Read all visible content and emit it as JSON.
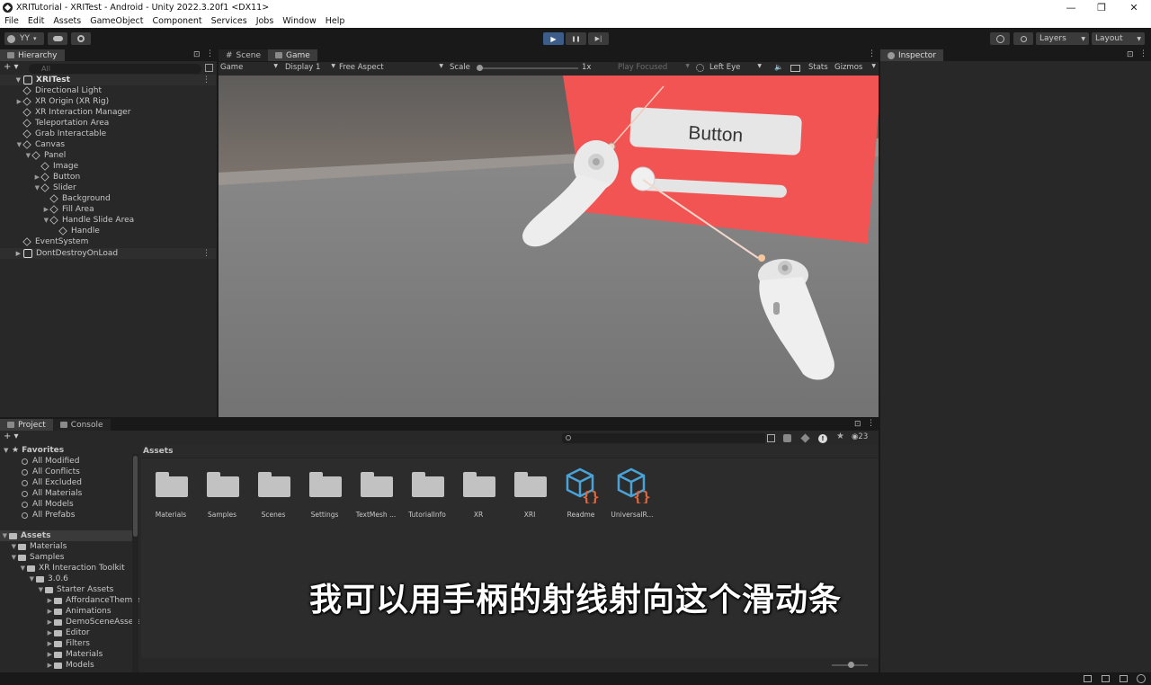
{
  "window": {
    "title": "XRITutorial - XRITest - Android - Unity 2022.3.20f1 <DX11>",
    "controls": [
      "—",
      "❐",
      "✕"
    ]
  },
  "menu": [
    "File",
    "Edit",
    "Assets",
    "GameObject",
    "Component",
    "Services",
    "Jobs",
    "Window",
    "Help"
  ],
  "toolbar": {
    "account": "YY",
    "account_caret": "▾",
    "layers": "Layers",
    "layout": "Layout",
    "play": "▶",
    "pause": "❚❚",
    "step": "▶|"
  },
  "hierarchy": {
    "tab": "Hierarchy",
    "add": "+ ▾",
    "search_placeholder": "All",
    "scene": "XRITest",
    "items": [
      {
        "label": "Directional Light",
        "depth": 1,
        "expand": ""
      },
      {
        "label": "XR Origin (XR Rig)",
        "depth": 1,
        "expand": "▶"
      },
      {
        "label": "XR Interaction Manager",
        "depth": 1,
        "expand": ""
      },
      {
        "label": "Teleportation Area",
        "depth": 1,
        "expand": ""
      },
      {
        "label": "Grab Interactable",
        "depth": 1,
        "expand": ""
      },
      {
        "label": "Canvas",
        "depth": 1,
        "expand": "▼"
      },
      {
        "label": "Panel",
        "depth": 2,
        "expand": "▼"
      },
      {
        "label": "Image",
        "depth": 3,
        "expand": ""
      },
      {
        "label": "Button",
        "depth": 3,
        "expand": "▶"
      },
      {
        "label": "Slider",
        "depth": 3,
        "expand": "▼"
      },
      {
        "label": "Background",
        "depth": 4,
        "expand": ""
      },
      {
        "label": "Fill Area",
        "depth": 4,
        "expand": "▶"
      },
      {
        "label": "Handle Slide Area",
        "depth": 4,
        "expand": "▼"
      },
      {
        "label": "Handle",
        "depth": 5,
        "expand": ""
      },
      {
        "label": "EventSystem",
        "depth": 1,
        "expand": ""
      }
    ],
    "dont_destroy": "DontDestroyOnLoad"
  },
  "view": {
    "tabs": [
      "Scene",
      "Game"
    ],
    "active_tab": "Game",
    "game_label": "Game",
    "display": "Display 1",
    "aspect": "Free Aspect",
    "scale_label": "Scale",
    "scale_value": "1x",
    "play_focused": "Play Focused",
    "eye": "Left Eye",
    "stats": "Stats",
    "gizmos": "Gizmos",
    "ui_button_text": "Button",
    "slider_value": 0.0
  },
  "inspector": {
    "tab": "Inspector"
  },
  "project": {
    "tabs": [
      "Project",
      "Console"
    ],
    "favorites_header": "Favorites",
    "favorites": [
      "All Modified",
      "All Conflicts",
      "All Excluded",
      "All Materials",
      "All Models",
      "All Prefabs"
    ],
    "tree": [
      {
        "label": "Assets",
        "depth": 0,
        "bold": true
      },
      {
        "label": "Materials",
        "depth": 1
      },
      {
        "label": "Samples",
        "depth": 1
      },
      {
        "label": "XR Interaction Toolkit",
        "depth": 2
      },
      {
        "label": "3.0.6",
        "depth": 3
      },
      {
        "label": "Starter Assets",
        "depth": 4
      },
      {
        "label": "AffordanceThemes",
        "depth": 5
      },
      {
        "label": "Animations",
        "depth": 5
      },
      {
        "label": "DemoSceneAssets",
        "depth": 5
      },
      {
        "label": "Editor",
        "depth": 5
      },
      {
        "label": "Filters",
        "depth": 5
      },
      {
        "label": "Materials",
        "depth": 5
      },
      {
        "label": "Models",
        "depth": 5
      }
    ],
    "breadcrumb": "Assets",
    "hidden_count": "23",
    "assets": [
      {
        "name": "Materials",
        "kind": "folder"
      },
      {
        "name": "Samples",
        "kind": "folder"
      },
      {
        "name": "Scenes",
        "kind": "folder"
      },
      {
        "name": "Settings",
        "kind": "folder"
      },
      {
        "name": "TextMesh ...",
        "kind": "folder"
      },
      {
        "name": "TutorialInfo",
        "kind": "folder"
      },
      {
        "name": "XR",
        "kind": "folder"
      },
      {
        "name": "XRI",
        "kind": "folder"
      },
      {
        "name": "Readme",
        "kind": "script"
      },
      {
        "name": "UniversalR...",
        "kind": "script"
      }
    ]
  },
  "subtitle": "我可以用手柄的射线射向这个滑动条",
  "colors": {
    "accent": "#3c5d8a",
    "panel": "#f25454",
    "icon_blue": "#4aa3d8",
    "icon_orange": "#e8673a"
  }
}
